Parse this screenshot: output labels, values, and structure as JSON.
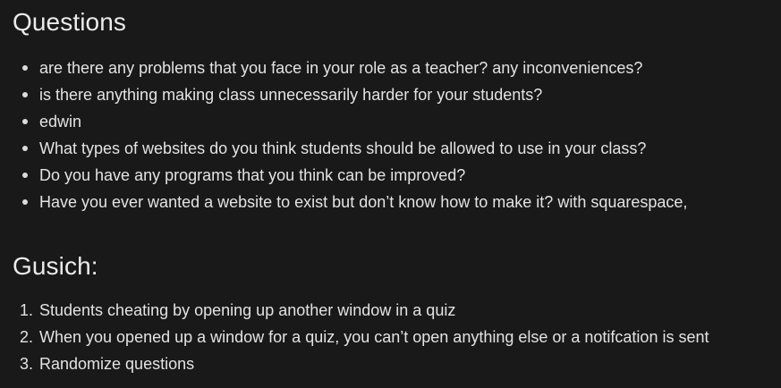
{
  "questions": {
    "title": "Questions",
    "items": [
      "are there any problems that you face in your role as a teacher? any inconveniences?",
      "is there anything making class unnecessarily harder for your students?",
      "edwin",
      "What types of websites do you think students should be allowed to use in your class?",
      "Do you have any programs that you think can be improved?",
      "Have you ever wanted a website to exist but don’t know how to make it? with squarespace,"
    ]
  },
  "gusich": {
    "title": "Gusich:",
    "items": [
      {
        "marker": "1.",
        "text": "Students cheating by opening up another window in a quiz"
      },
      {
        "marker": "2.",
        "text": "When you opened up a window for a quiz, you can’t open anything else or a notifcation is sent"
      },
      {
        "marker": "3.",
        "text": "Randomize questions"
      }
    ]
  }
}
